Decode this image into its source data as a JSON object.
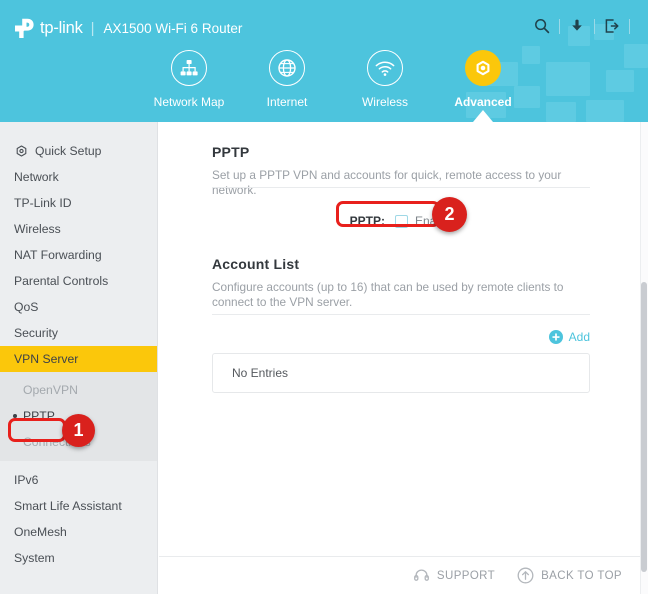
{
  "header": {
    "brand": "tp-link",
    "separator": "|",
    "model": "AX1500 Wi-Fi 6 Router",
    "actions": [
      {
        "name": "search-icon",
        "label": "Search"
      },
      {
        "name": "firmware-update-icon",
        "label": "Firmware Update"
      },
      {
        "name": "logout-icon",
        "label": "Log Out"
      }
    ]
  },
  "nav": {
    "tabs": [
      {
        "label": "Network Map",
        "icon": "network-map-icon",
        "active": false
      },
      {
        "label": "Internet",
        "icon": "globe-icon",
        "active": false
      },
      {
        "label": "Wireless",
        "icon": "wifi-icon",
        "active": false
      },
      {
        "label": "Advanced",
        "icon": "gear-icon",
        "active": true
      }
    ],
    "active_color": "#fbc70b"
  },
  "sidebar": {
    "items": [
      {
        "label": "Quick Setup",
        "icon": "gear-icon",
        "active": false
      },
      {
        "label": "Network",
        "active": false
      },
      {
        "label": "TP-Link ID",
        "active": false
      },
      {
        "label": "Wireless",
        "active": false
      },
      {
        "label": "NAT Forwarding",
        "active": false
      },
      {
        "label": "Parental Controls",
        "active": false
      },
      {
        "label": "QoS",
        "active": false
      },
      {
        "label": "Security",
        "active": false
      },
      {
        "label": "VPN Server",
        "active": true
      }
    ],
    "sub_items": [
      {
        "label": "OpenVPN",
        "current": false
      },
      {
        "label": "PPTP",
        "current": true
      },
      {
        "label": "Connections",
        "current": false
      }
    ],
    "items_after": [
      {
        "label": "IPv6",
        "active": false
      },
      {
        "label": "Smart Life Assistant",
        "active": false
      },
      {
        "label": "OneMesh",
        "active": false
      },
      {
        "label": "System",
        "active": false
      }
    ],
    "highlight_color": "#fbc70b"
  },
  "content": {
    "pptp": {
      "title": "PPTP",
      "description": "Set up a PPTP VPN and accounts for quick, remote access to your network.",
      "field_label": "PPTP:",
      "checkbox_label": "Enable",
      "checkbox_checked": false
    },
    "account_list": {
      "title": "Account List",
      "description": "Configure accounts (up to 16) that can be used by remote clients to connect to the VPN server.",
      "add_label": "Add",
      "add_icon": "plus-circle-icon",
      "empty_text": "No Entries",
      "accent_color": "#4dc4dd"
    }
  },
  "footer": {
    "support_label": "SUPPORT",
    "support_icon": "headset-icon",
    "back_to_top_label": "BACK TO TOP",
    "back_to_top_icon": "arrow-up-circle-icon"
  },
  "annotations": [
    {
      "badge": "1",
      "target": "sidebar-sub-item-pptp"
    },
    {
      "badge": "2",
      "target": "pptp-enable-row"
    }
  ]
}
